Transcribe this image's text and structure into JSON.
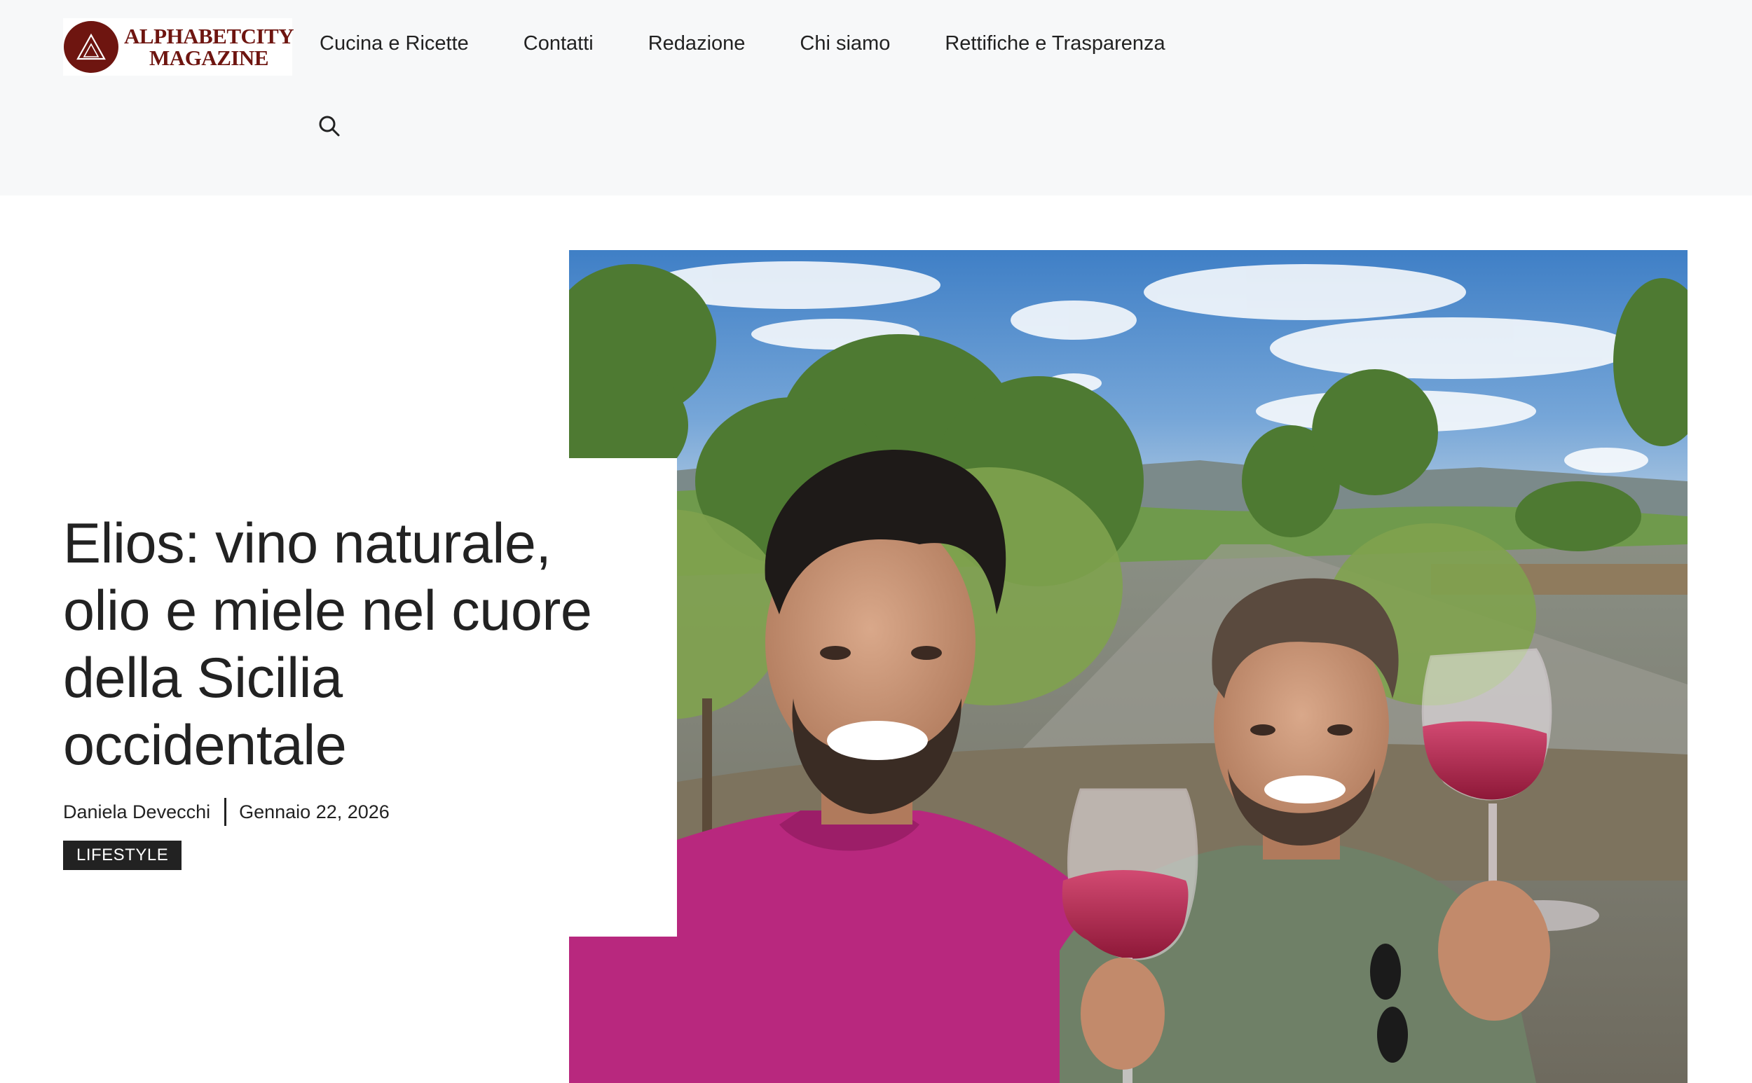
{
  "site": {
    "logo_line1": "ALPHABETCITY",
    "logo_line2": "MAGAZINE",
    "logo_icon": "triangle-emblem-icon",
    "brand_color": "#6e1510"
  },
  "nav": {
    "items": [
      {
        "label": "Cucina e Ricette"
      },
      {
        "label": "Contatti"
      },
      {
        "label": "Redazione"
      },
      {
        "label": "Chi siamo"
      },
      {
        "label": "Rettifiche e Trasparenza"
      }
    ],
    "search_icon": "search-icon"
  },
  "article": {
    "title": "Elios: vino naturale, olio e miele nel cuore della Sicilia occidentale",
    "author": "Daniela Devecchi",
    "date": "Gennaio 22, 2026",
    "category": "LIFESTYLE",
    "category_bg": "#222222"
  }
}
